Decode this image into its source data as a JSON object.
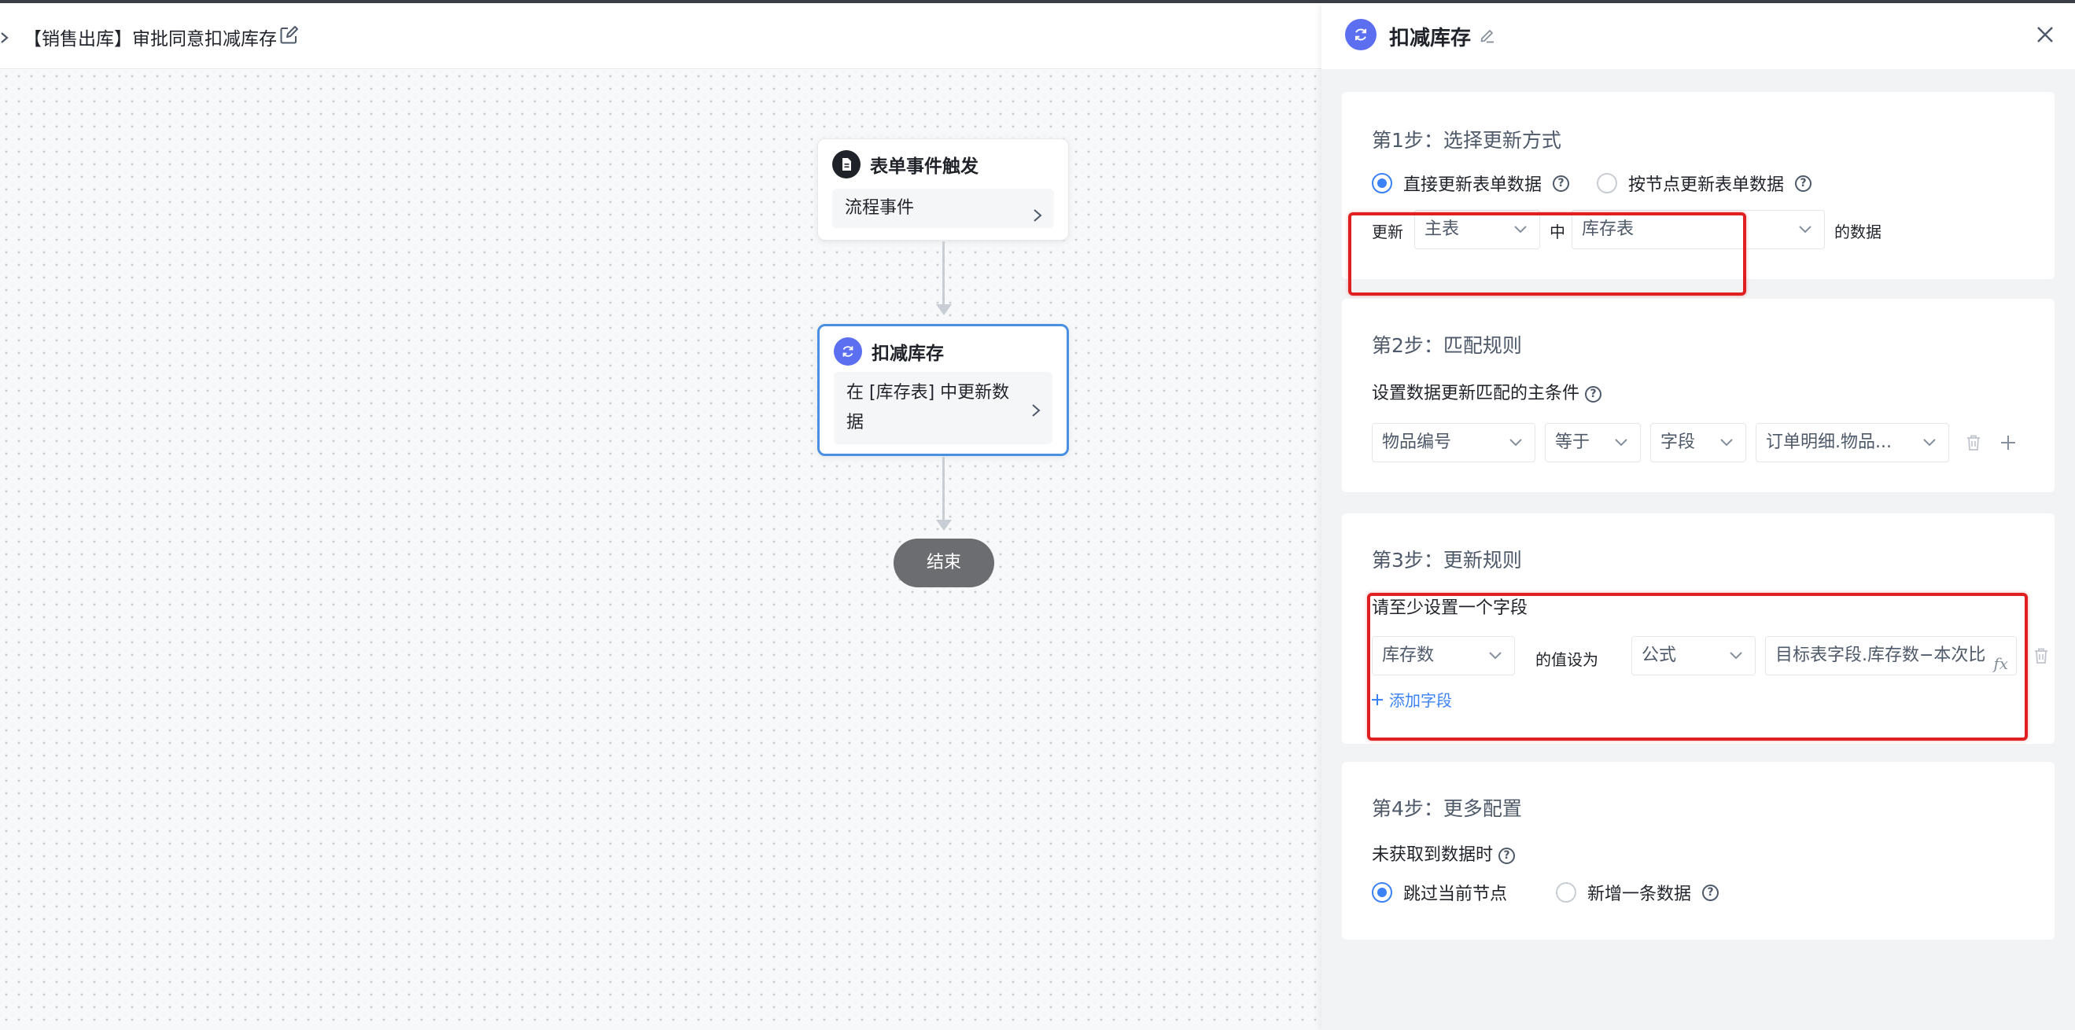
{
  "header": {
    "flow_title": "【销售出库】审批同意扣减库存"
  },
  "canvas": {
    "trigger_node": {
      "title": "表单事件触发",
      "body": "流程事件"
    },
    "update_node": {
      "title": "扣减库存",
      "body": "在 [库存表] 中更新数据"
    },
    "end_node": {
      "label": "结束"
    }
  },
  "panel": {
    "title": "扣减库存",
    "step1": {
      "title": "第1步：选择更新方式",
      "option_direct": "直接更新表单数据",
      "option_by_node": "按节点更新表单数据",
      "update_label": "更新",
      "table_type": "主表",
      "in_label": "中",
      "target_table": "库存表",
      "data_suffix": "的数据"
    },
    "step2": {
      "title": "第2步：匹配规则",
      "condition_label": "设置数据更新匹配的主条件",
      "field": "物品编号",
      "operator": "等于",
      "value_type": "字段",
      "value": "订单明细.物品..."
    },
    "step3": {
      "title": "第3步：更新规则",
      "hint": "请至少设置一个字段",
      "field": "库存数",
      "set_value_label": "的值设为",
      "value_mode": "公式",
      "formula": "目标表字段.库存数−本次比",
      "add_field": "添加字段"
    },
    "step4": {
      "title": "第4步：更多配置",
      "no_data_label": "未获取到数据时",
      "option_skip": "跳过当前节点",
      "option_add": "新增一条数据"
    }
  },
  "colors": {
    "accent": "#3b82f6",
    "node_icon": "#5b6ff0",
    "highlight": "#e02020",
    "end_node": "#6b6d70"
  }
}
